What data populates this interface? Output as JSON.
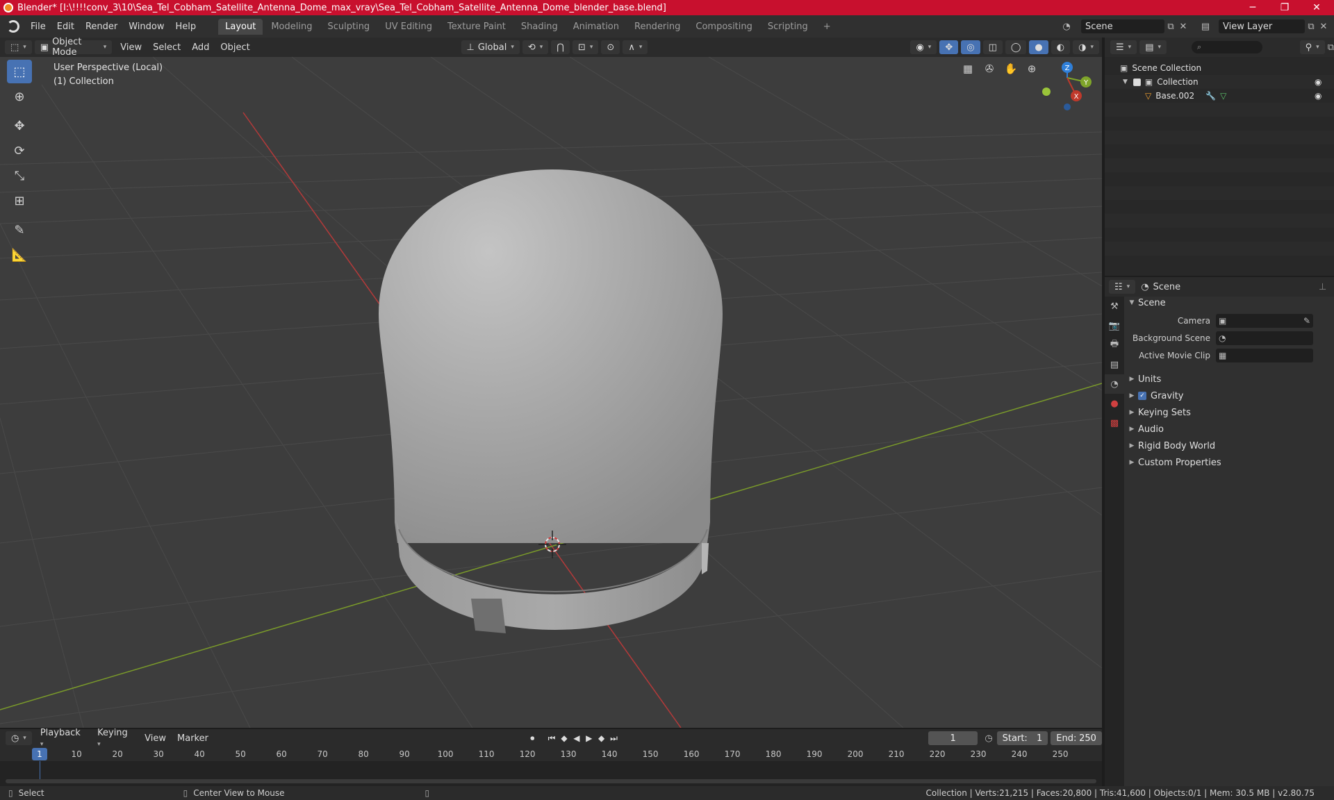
{
  "window": {
    "title": "Blender* [I:\\!!!!conv_3\\10\\Sea_Tel_Cobham_Satellite_Antenna_Dome_max_vray\\Sea_Tel_Cobham_Satellite_Antenna_Dome_blender_base.blend]",
    "minimize": "─",
    "maximize": "❐",
    "close": "✕"
  },
  "menubar": {
    "items": [
      "File",
      "Edit",
      "Render",
      "Window",
      "Help"
    ],
    "workspaces": [
      "Layout",
      "Modeling",
      "Sculpting",
      "UV Editing",
      "Texture Paint",
      "Shading",
      "Animation",
      "Rendering",
      "Compositing",
      "Scripting"
    ],
    "active_workspace": "Layout",
    "add_workspace": "+",
    "scene_name": "Scene",
    "view_layer": "View Layer"
  },
  "viewport_header": {
    "mode": "Object Mode",
    "menus": [
      "View",
      "Select",
      "Add",
      "Object"
    ],
    "transform_orientation": "Global"
  },
  "viewport": {
    "perspective_label": "User Perspective (Local)",
    "collection_label": "(1) Collection",
    "colors": {
      "x_axis": "#c0392b",
      "y_axis": "#7fa52a",
      "z_axis": "#2f7fd8",
      "tool_active": "#4772b3"
    },
    "gizmo": {
      "x": "X",
      "y": "Y",
      "z": "Z"
    }
  },
  "outliner": {
    "search_placeholder": "",
    "rows": [
      {
        "label": "Scene Collection"
      },
      {
        "label": "Collection"
      },
      {
        "label": "Base.002"
      }
    ]
  },
  "properties": {
    "context": "Scene",
    "panel_title": "Scene",
    "fields": [
      {
        "label": "Camera"
      },
      {
        "label": "Background Scene"
      },
      {
        "label": "Active Movie Clip"
      }
    ],
    "subpanels": [
      "Units",
      "Gravity",
      "Keying Sets",
      "Audio",
      "Rigid Body World",
      "Custom Properties"
    ]
  },
  "timeline": {
    "menus": [
      "Playback",
      "Keying",
      "View",
      "Marker"
    ],
    "current_frame": "1",
    "start_label": "Start:",
    "start": "1",
    "end_label": "End:",
    "end": "250",
    "ticks": [
      "10",
      "20",
      "30",
      "40",
      "50",
      "60",
      "70",
      "80",
      "90",
      "100",
      "110",
      "120",
      "130",
      "140",
      "150",
      "160",
      "170",
      "180",
      "190",
      "200",
      "210",
      "220",
      "230",
      "240",
      "250"
    ],
    "playhead": "1"
  },
  "statusbar": {
    "select": "Select",
    "center_view": "Center View to Mouse",
    "stats": "Collection | Verts:21,215 | Faces:20,800 | Tris:41,600 | Objects:0/1 | Mem: 30.5 MB | v2.80.75"
  }
}
